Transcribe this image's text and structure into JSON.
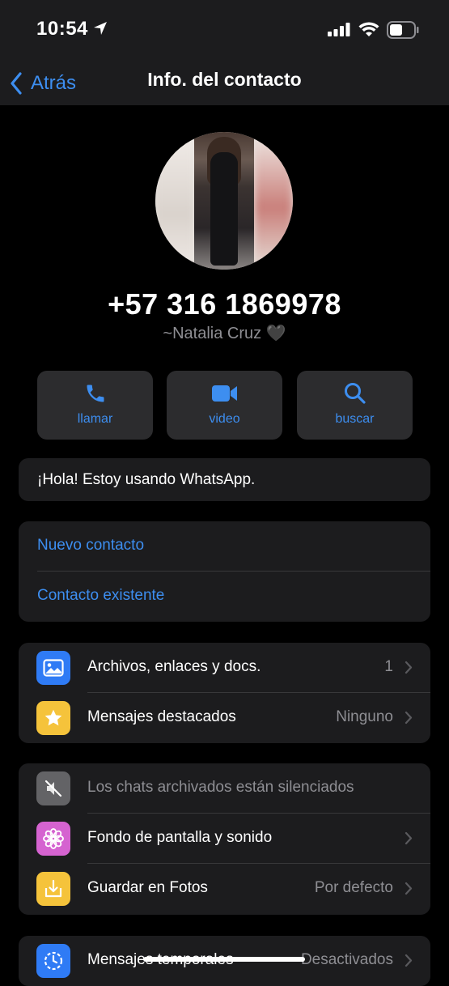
{
  "status_bar": {
    "time": "10:54"
  },
  "nav": {
    "back_label": "Atrás",
    "title": "Info. del contacto"
  },
  "contact": {
    "phone": "+57 316 1869978",
    "name": "~Natalia Cruz 🖤"
  },
  "actions": [
    {
      "label": "llamar",
      "icon": "phone-icon"
    },
    {
      "label": "video",
      "icon": "video-icon"
    },
    {
      "label": "buscar",
      "icon": "search-icon"
    }
  ],
  "about": "¡Hola! Estoy usando WhatsApp.",
  "contact_options": [
    {
      "label": "Nuevo contacto"
    },
    {
      "label": "Contacto existente"
    }
  ],
  "media_section": [
    {
      "label": "Archivos, enlaces y docs.",
      "value": "1",
      "icon": "photo-icon",
      "color": "#2f7bf5"
    },
    {
      "label": "Mensajes destacados",
      "value": "Ninguno",
      "icon": "star-icon",
      "color": "#f5c33b"
    }
  ],
  "settings_section": [
    {
      "label": "Los chats archivados están silenciados",
      "value": "",
      "icon": "mute-icon",
      "color": "#636366"
    },
    {
      "label": "Fondo de pantalla y sonido",
      "value": "",
      "icon": "flower-icon",
      "color": "#d563d0"
    },
    {
      "label": "Guardar en Fotos",
      "value": "Por defecto",
      "icon": "download-icon",
      "color": "#f5c33b"
    }
  ],
  "timer_section": [
    {
      "label": "Mensajes temporales",
      "value": "Desactivados",
      "icon": "timer-icon",
      "color": "#2f7bf5"
    }
  ]
}
